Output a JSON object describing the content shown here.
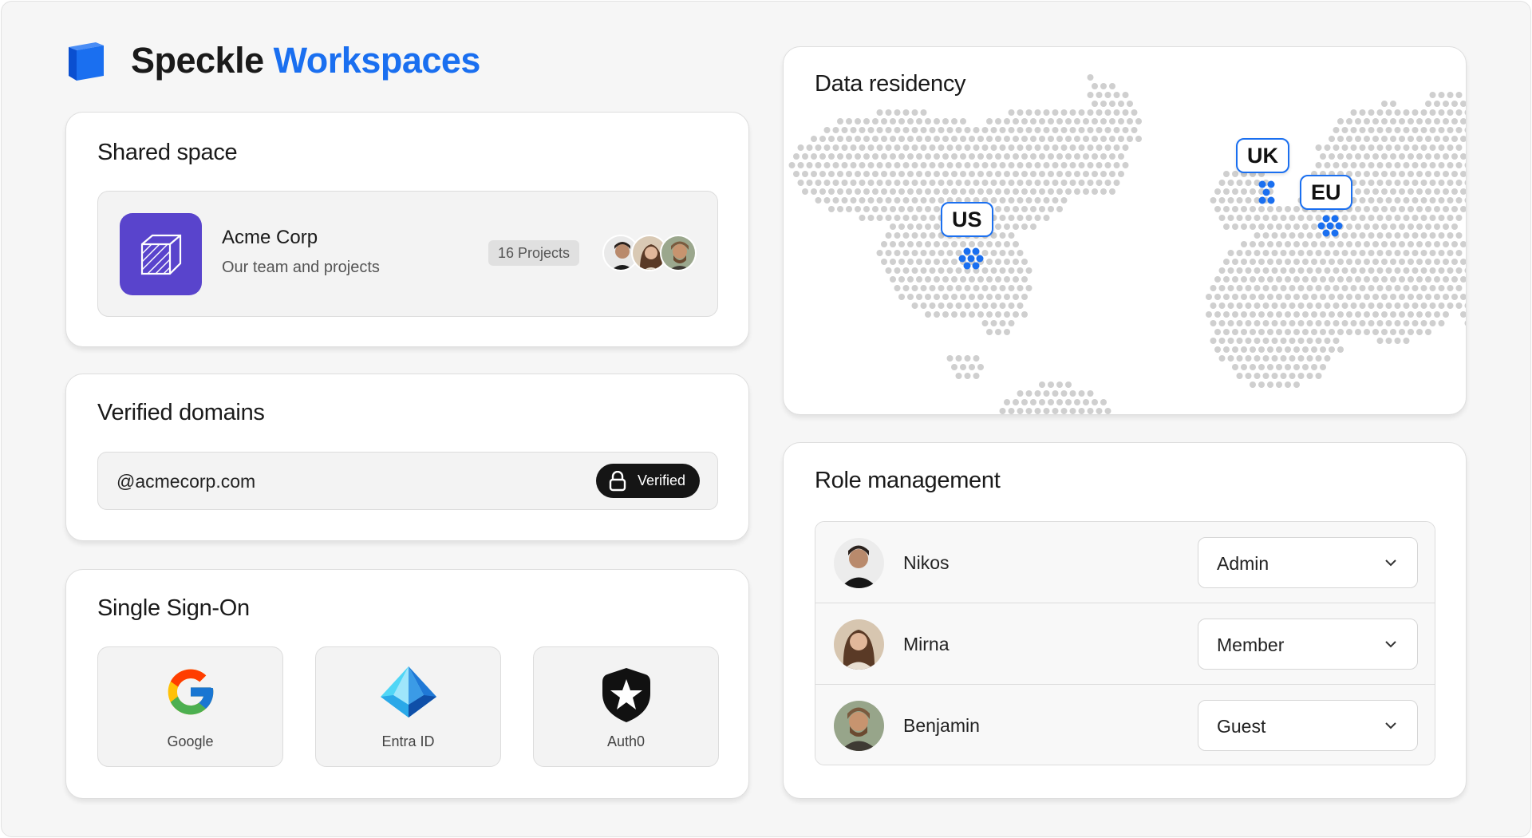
{
  "header": {
    "title_main": "Speckle",
    "title_accent": "Workspaces"
  },
  "colors": {
    "accent": "#1a6ff0",
    "space_logo": "#5944cc",
    "pill": "#151515"
  },
  "shared_space": {
    "title": "Shared space",
    "workspace_name": "Acme Corp",
    "workspace_desc": "Our team and projects",
    "projects_badge": "16 Projects",
    "member_avatars": [
      "avatar-nikos",
      "avatar-mirna",
      "avatar-benjamin"
    ]
  },
  "verified_domains": {
    "title": "Verified domains",
    "domain": "@acmecorp.com",
    "status": "Verified",
    "status_icon": "lock-icon"
  },
  "sso": {
    "title": "Single Sign-On",
    "providers": [
      {
        "label": "Google",
        "icon": "google-icon"
      },
      {
        "label": "Entra ID",
        "icon": "entra-id-icon"
      },
      {
        "label": "Auth0",
        "icon": "auth0-icon"
      }
    ]
  },
  "data_residency": {
    "title": "Data residency",
    "regions": [
      "US",
      "UK",
      "EU"
    ]
  },
  "role_management": {
    "title": "Role management",
    "members": [
      {
        "name": "Nikos",
        "role": "Admin"
      },
      {
        "name": "Mirna",
        "role": "Member"
      },
      {
        "name": "Benjamin",
        "role": "Guest"
      }
    ]
  }
}
